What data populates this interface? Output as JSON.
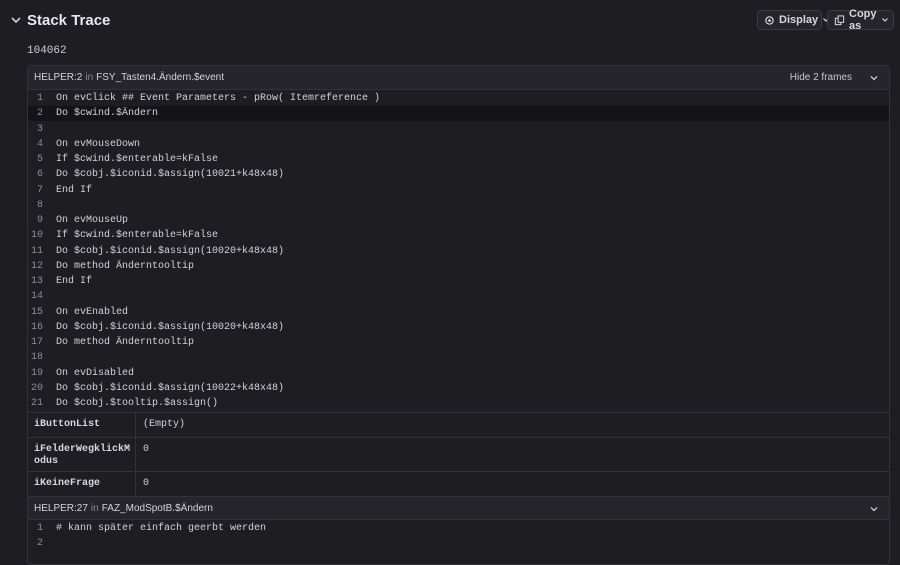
{
  "section": {
    "title": "Stack Trace",
    "event_id": "104062"
  },
  "toolbar": {
    "display_label": "Display",
    "copy_label": "Copy as"
  },
  "frames": [
    {
      "module": "HELPER:2",
      "in_word": "in",
      "function": "FSY_Tasten4.Ändern.$event",
      "hide_label": "Hide 2 frames",
      "lines": [
        {
          "n": "1",
          "t": "On evClick ## Event Parameters - pRow( Itemreference )"
        },
        {
          "n": "2",
          "t": "Do $cwind.$Ändern"
        },
        {
          "n": "3",
          "t": ""
        },
        {
          "n": "4",
          "t": "On evMouseDown"
        },
        {
          "n": "5",
          "t": "If $cwind.$enterable=kFalse"
        },
        {
          "n": "6",
          "t": "Do $cobj.$iconid.$assign(10021+k48x48)"
        },
        {
          "n": "7",
          "t": "End If"
        },
        {
          "n": "8",
          "t": ""
        },
        {
          "n": "9",
          "t": "On evMouseUp"
        },
        {
          "n": "10",
          "t": "If $cwind.$enterable=kFalse"
        },
        {
          "n": "11",
          "t": "Do $cobj.$iconid.$assign(10020+k48x48)"
        },
        {
          "n": "12",
          "t": "Do method Änderntooltip"
        },
        {
          "n": "13",
          "t": "End If"
        },
        {
          "n": "14",
          "t": ""
        },
        {
          "n": "15",
          "t": "On evEnabled"
        },
        {
          "n": "16",
          "t": "Do $cobj.$iconid.$assign(10020+k48x48)"
        },
        {
          "n": "17",
          "t": "Do method Änderntooltip"
        },
        {
          "n": "18",
          "t": ""
        },
        {
          "n": "19",
          "t": "On evDisabled"
        },
        {
          "n": "20",
          "t": "Do $cobj.$iconid.$assign(10022+k48x48)"
        },
        {
          "n": "21",
          "t": "Do $cobj.$tooltip.$assign()"
        }
      ],
      "variables": [
        {
          "key": "iButtonList",
          "value": "(Empty)"
        },
        {
          "key": "iFelderWegklickModus",
          "value": "0"
        },
        {
          "key": "iKeineFrage",
          "value": "0"
        }
      ]
    },
    {
      "module": "HELPER:27",
      "in_word": "in",
      "function": "FAZ_ModSpotB.$Ändern",
      "lines": [
        {
          "n": "1",
          "t": "# kann später einfach geerbt werden"
        },
        {
          "n": "2",
          "t": ""
        }
      ]
    }
  ]
}
